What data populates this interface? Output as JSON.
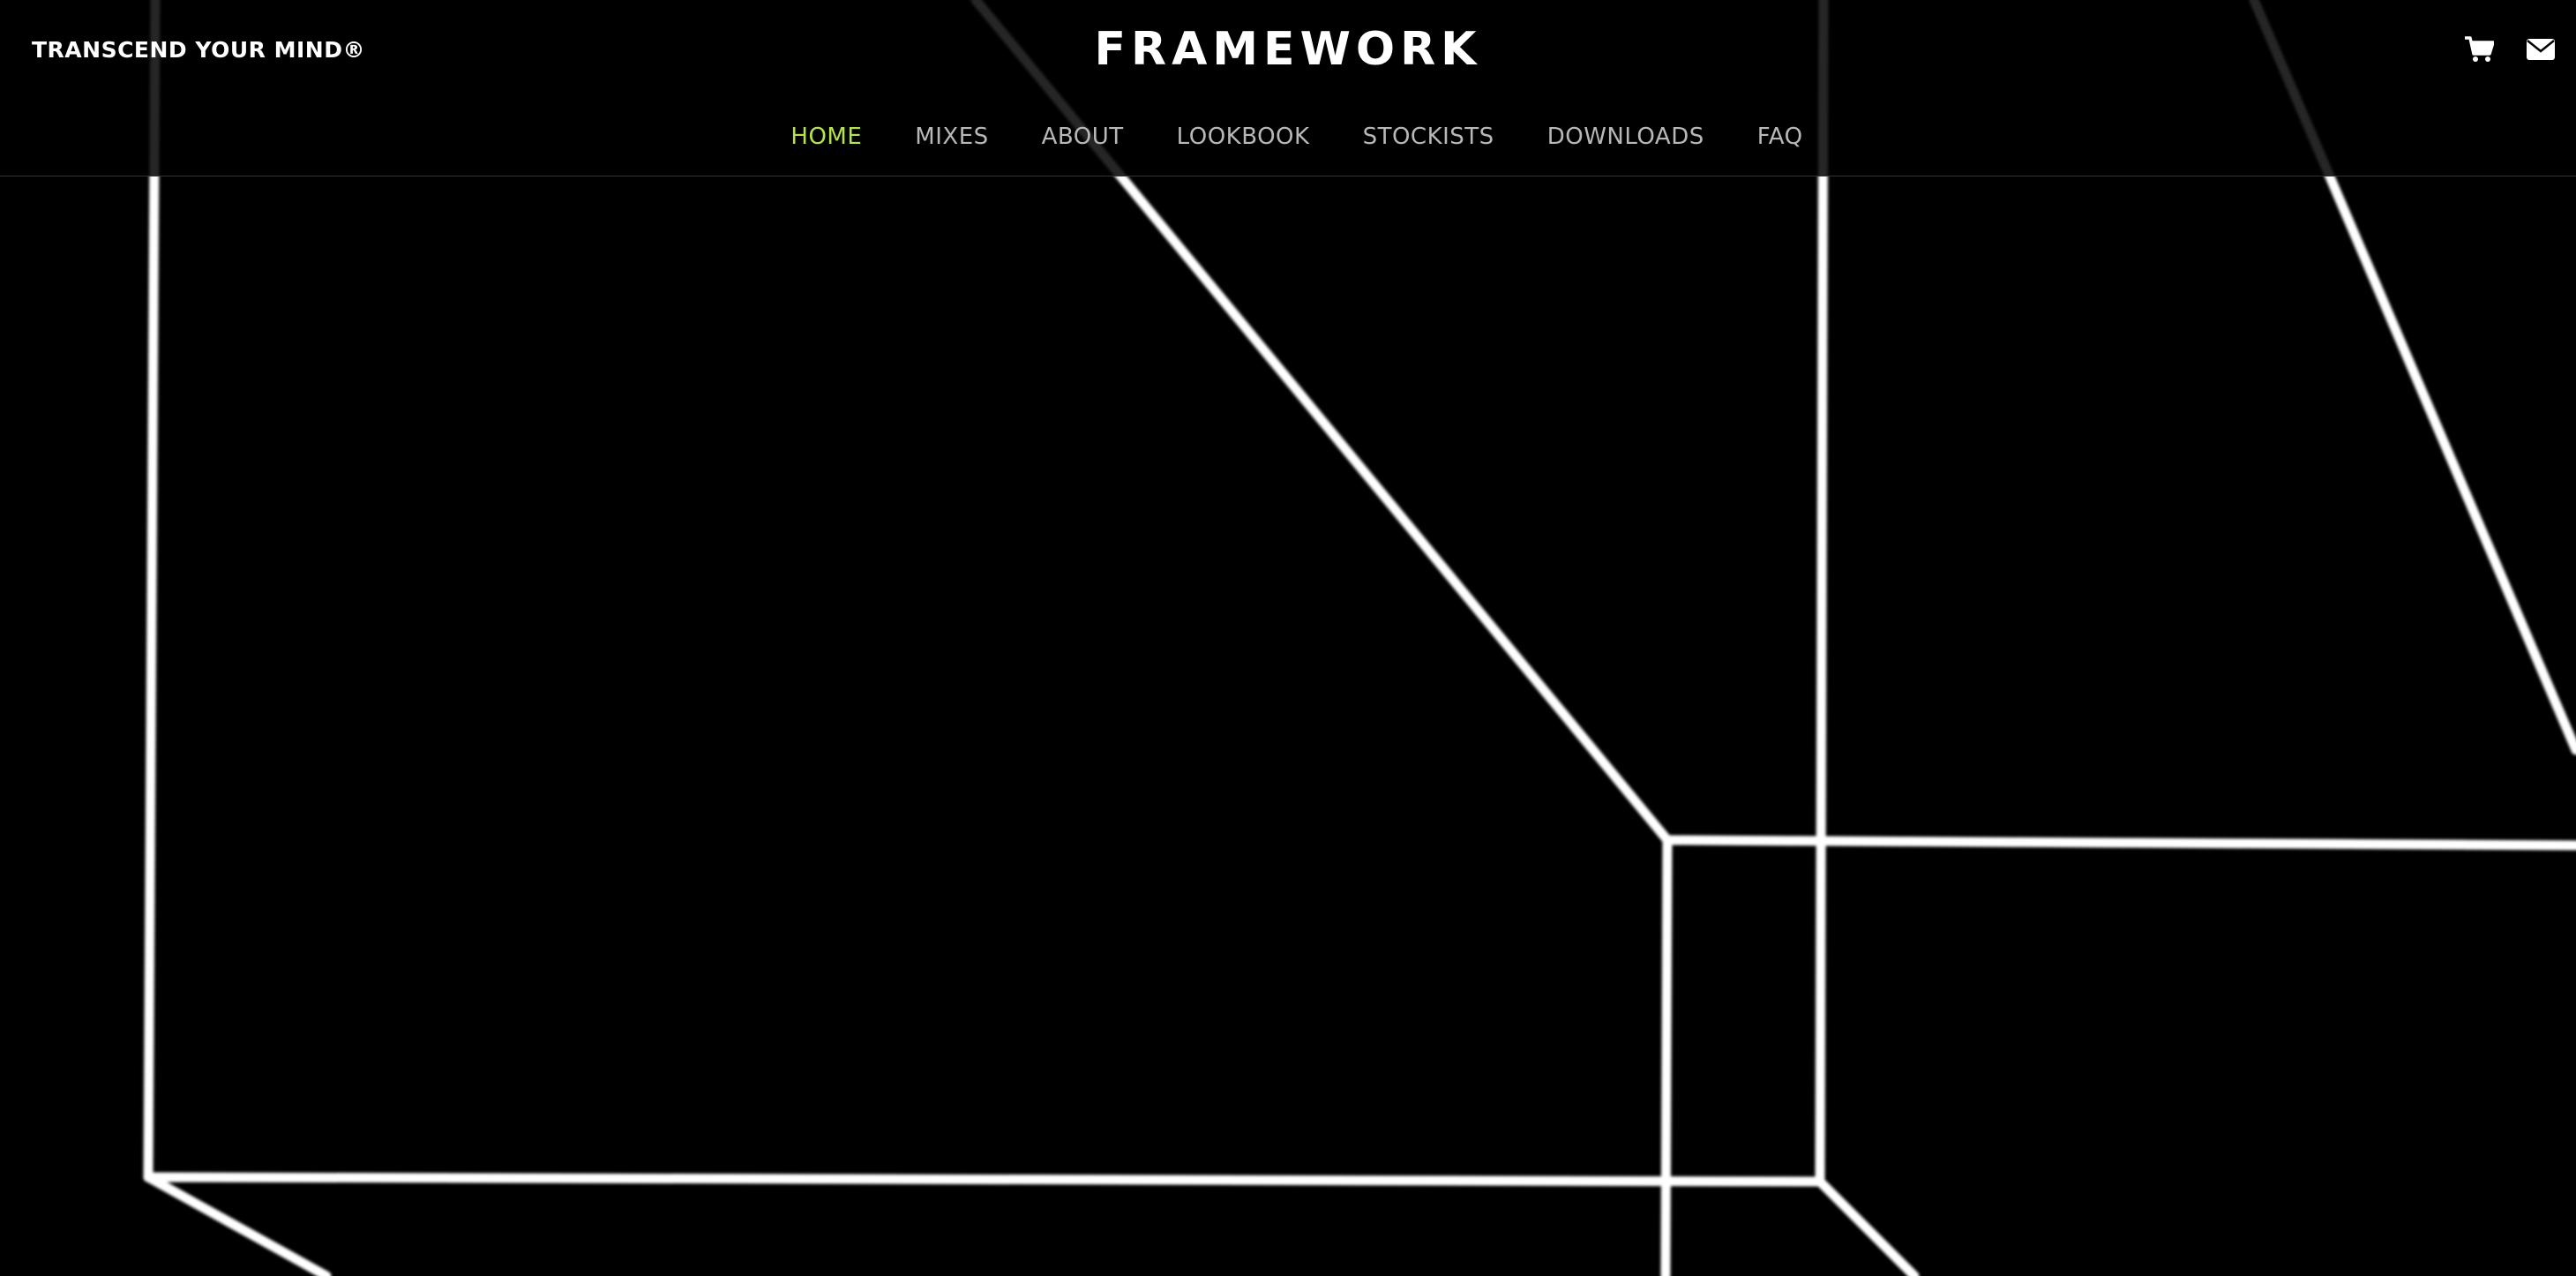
{
  "brand": {
    "tagline": "TRANSCEND YOUR MIND®",
    "logo": "FRAMEWORK"
  },
  "nav": {
    "items": [
      {
        "label": "HOME",
        "active": true
      },
      {
        "label": "MIXES",
        "active": false
      },
      {
        "label": "ABOUT",
        "active": false
      },
      {
        "label": "LOOKBOOK",
        "active": false
      },
      {
        "label": "STOCKISTS",
        "active": false
      },
      {
        "label": "DOWNLOADS",
        "active": false
      },
      {
        "label": "FAQ",
        "active": false
      }
    ]
  },
  "header_icons": {
    "cart": "cart-icon",
    "mail": "mail-icon"
  },
  "colors": {
    "background": "#000000",
    "accent": "#b5e24f",
    "nav_text": "#b8b8b8",
    "lines": "#ffffff"
  }
}
